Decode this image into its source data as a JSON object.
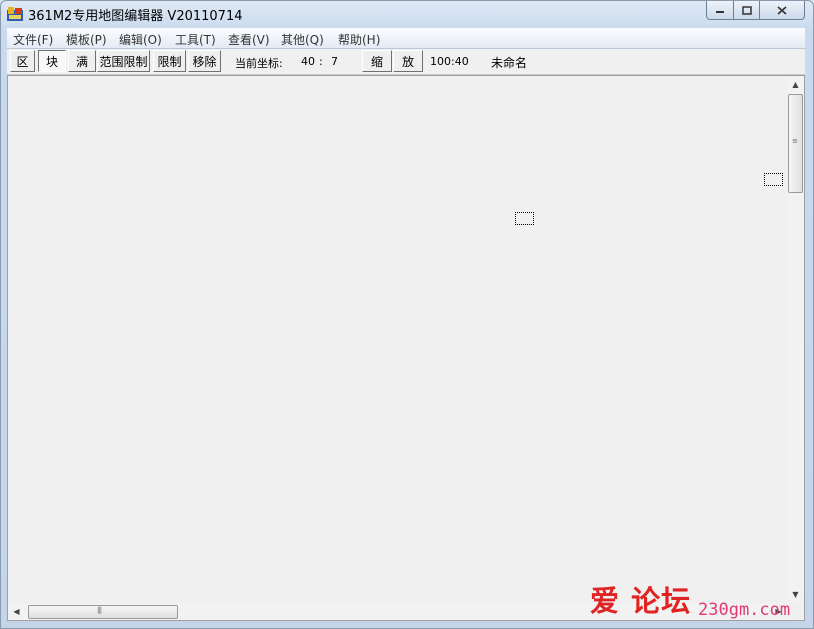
{
  "window": {
    "title": "361M2专用地图编辑器 V20110714"
  },
  "menu": [
    {
      "label": "文件(F)"
    },
    {
      "label": "模板(P)"
    },
    {
      "label": "编辑(O)"
    },
    {
      "label": "工具(T)"
    },
    {
      "label": "查看(V)"
    },
    {
      "label": "其他(Q)"
    },
    {
      "label": "帮助(H)"
    }
  ],
  "toolbar": {
    "btn_area": "区",
    "btn_block": "块",
    "btn_full": "满",
    "btn_range_limit": "范围限制",
    "btn_limit": "限制",
    "btn_remove": "移除",
    "coord_label": "当前坐标:",
    "coord_x": "40",
    "coord_sep": ":",
    "coord_y": "7",
    "btn_shrink": "缩",
    "btn_zoom": "放",
    "zoom_ratio": "100:40",
    "file_name": "未命名",
    "pressed_button": "块"
  },
  "watermark": {
    "text_cn": "爱 论坛",
    "url": "230gm.com"
  },
  "colors": {
    "canvas_bg": "#f0f0f0",
    "watermark_red": "#e02424",
    "watermark_pink": "#e23a6e"
  }
}
